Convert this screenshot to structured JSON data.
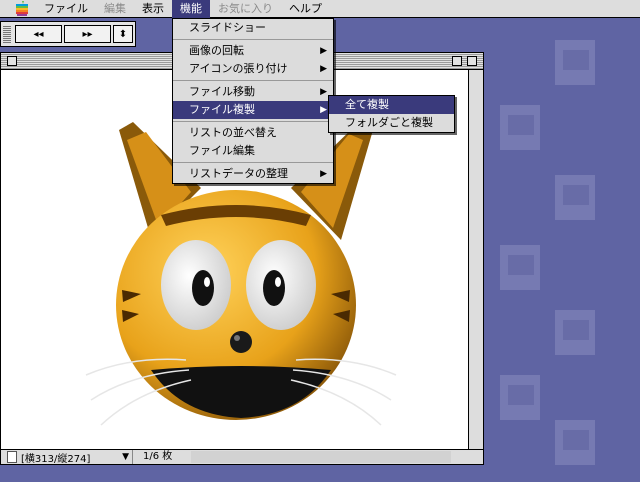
{
  "menubar": {
    "items": [
      {
        "label": "ファイル",
        "state": "normal"
      },
      {
        "label": "編集",
        "state": "disabled"
      },
      {
        "label": "表示",
        "state": "normal"
      },
      {
        "label": "機能",
        "state": "active"
      },
      {
        "label": "お気に入り",
        "state": "disabled"
      },
      {
        "label": "ヘルプ",
        "state": "normal"
      }
    ]
  },
  "palette": {
    "rewind_icon": "◂◂",
    "forward_icon": "▸▸",
    "stepper_icon": "⬍"
  },
  "function_menu": {
    "items": [
      {
        "label": "スライドショー",
        "submenu": false,
        "active": false,
        "separator_after": true
      },
      {
        "label": "画像の回転",
        "submenu": true,
        "active": false,
        "separator_after": false
      },
      {
        "label": "アイコンの張り付け",
        "submenu": true,
        "active": false,
        "separator_after": true
      },
      {
        "label": "ファイル移動",
        "submenu": true,
        "active": false,
        "separator_after": false
      },
      {
        "label": "ファイル複製",
        "submenu": true,
        "active": true,
        "separator_after": true
      },
      {
        "label": "リストの並べ替え",
        "submenu": false,
        "active": false,
        "separator_after": false
      },
      {
        "label": "ファイル編集",
        "submenu": false,
        "active": false,
        "separator_after": true
      },
      {
        "label": "リストデータの整理",
        "submenu": true,
        "active": false,
        "separator_after": false
      }
    ]
  },
  "copy_submenu": {
    "items": [
      {
        "label": "全て複製",
        "active": true
      },
      {
        "label": "フォルダごと複製",
        "active": false
      }
    ]
  },
  "status": {
    "dimensions": "[横313/縦274]",
    "count": "1/6 枚"
  },
  "colors": {
    "desktop": "#5f64a3",
    "highlight": "#3a3a7c",
    "cat_face": "#e8a21a"
  }
}
